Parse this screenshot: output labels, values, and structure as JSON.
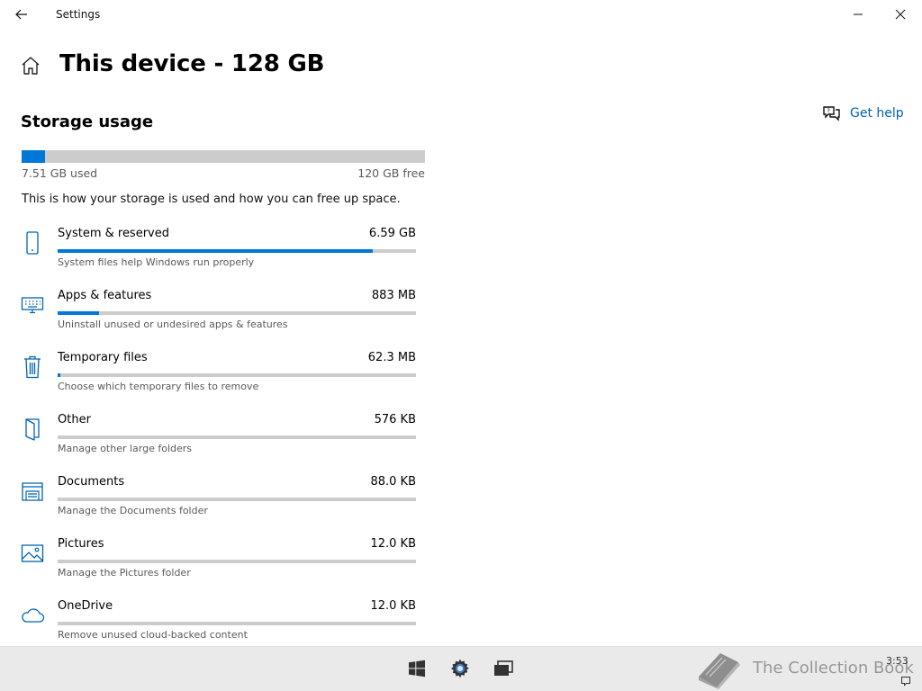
{
  "window": {
    "title": "Settings"
  },
  "page": {
    "title": "This device - 128 GB"
  },
  "help": {
    "label": "Get help"
  },
  "storage": {
    "section_title": "Storage usage",
    "used_label": "7.51 GB used",
    "free_label": "120 GB free",
    "used_fraction": 0.059,
    "description": "This is how your storage is used and how you can free up space."
  },
  "categories": [
    {
      "icon": "phone-icon",
      "name": "System & reserved",
      "size": "6.59 GB",
      "fraction": 0.88,
      "subtitle": "System files help Windows run properly"
    },
    {
      "icon": "keyboard-icon",
      "name": "Apps & features",
      "size": "883 MB",
      "fraction": 0.115,
      "subtitle": "Uninstall unused or undesired apps & features"
    },
    {
      "icon": "trash-icon",
      "name": "Temporary files",
      "size": "62.3 MB",
      "fraction": 0.008,
      "subtitle": "Choose which temporary files to remove"
    },
    {
      "icon": "folder-icon",
      "name": "Other",
      "size": "576 KB",
      "fraction": 0,
      "subtitle": "Manage other large folders"
    },
    {
      "icon": "documents-icon",
      "name": "Documents",
      "size": "88.0 KB",
      "fraction": 0,
      "subtitle": "Manage the Documents folder"
    },
    {
      "icon": "pictures-icon",
      "name": "Pictures",
      "size": "12.0 KB",
      "fraction": 0,
      "subtitle": "Manage the Pictures folder"
    },
    {
      "icon": "cloud-icon",
      "name": "OneDrive",
      "size": "12.0 KB",
      "fraction": 0,
      "subtitle": "Remove unused cloud-backed content"
    }
  ],
  "taskbar": {
    "clock": "3:53"
  },
  "watermark": {
    "text": "The Collection Book"
  },
  "colors": {
    "accent": "#0078d7",
    "link": "#0063b1",
    "track": "#cccccc"
  }
}
